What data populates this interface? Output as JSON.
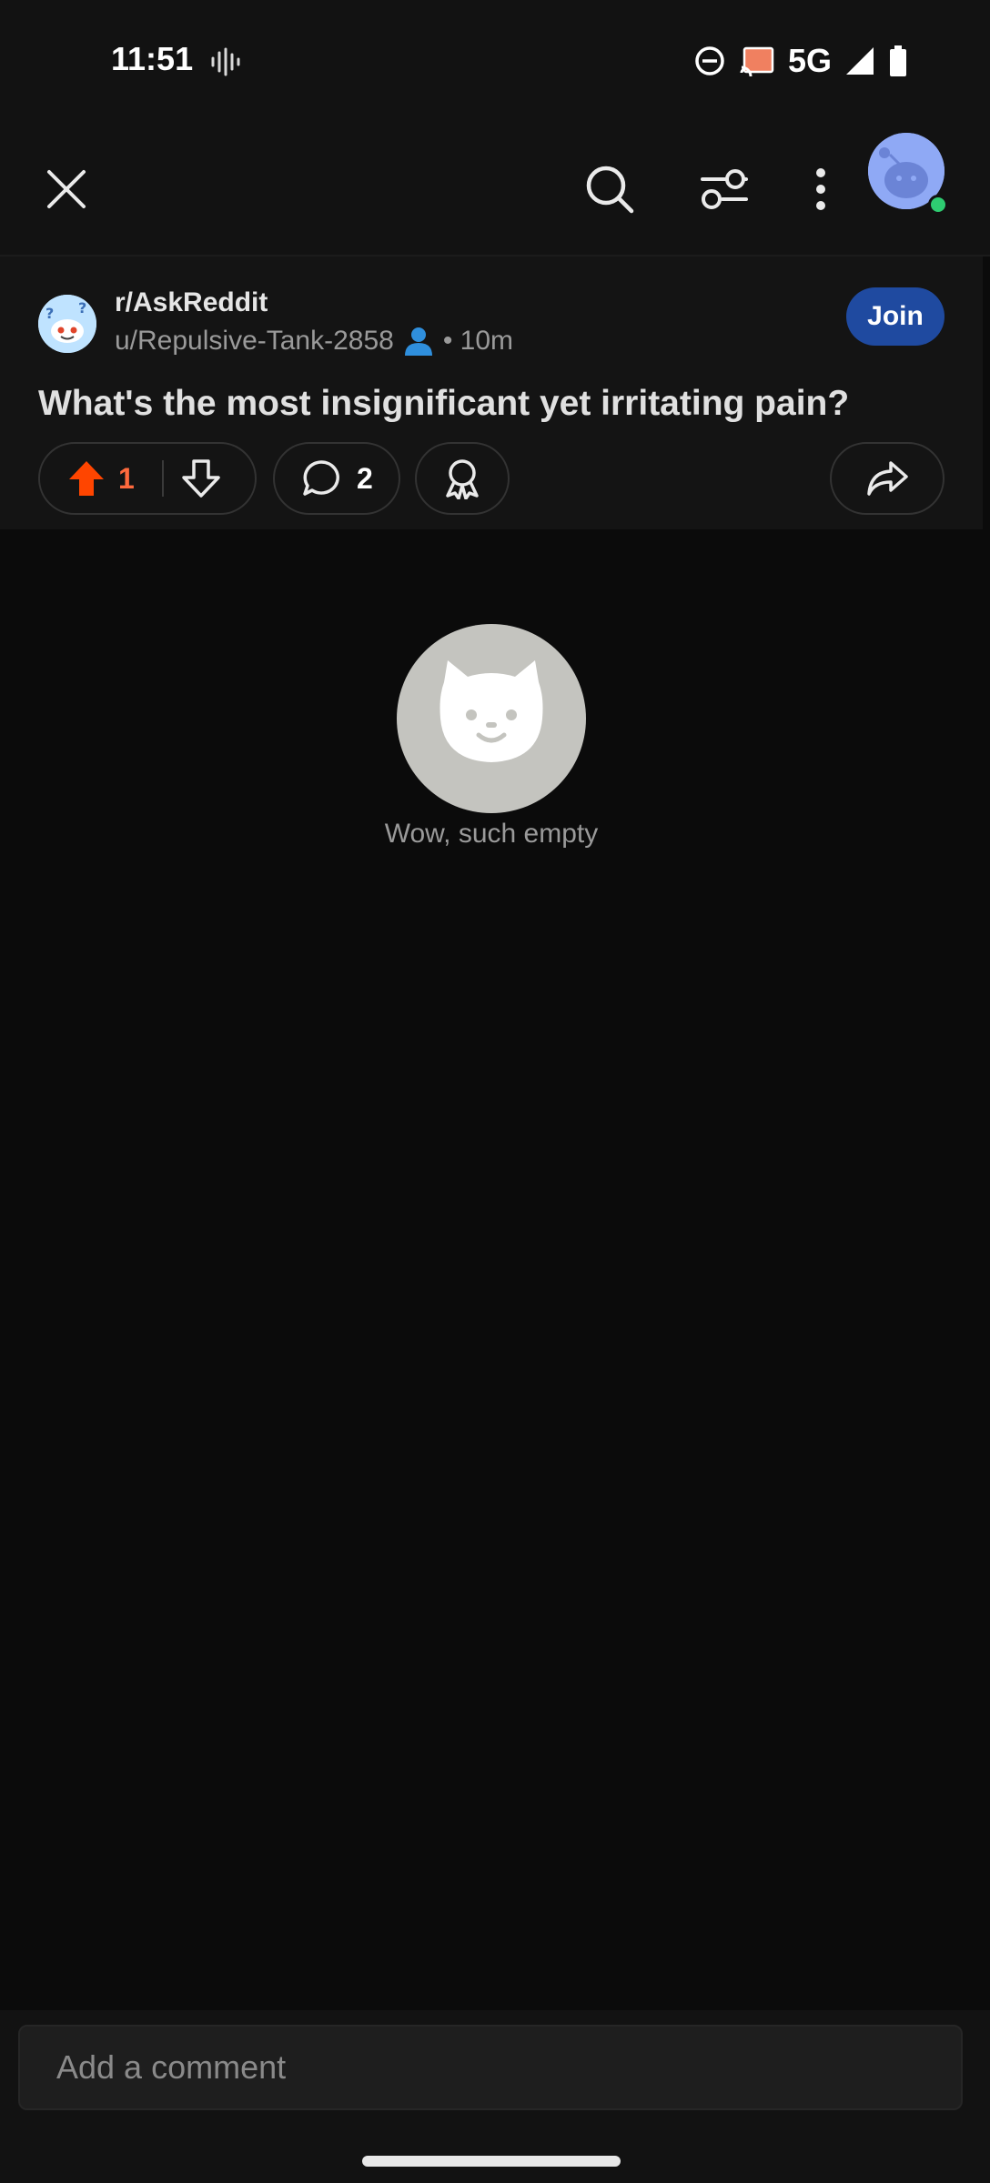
{
  "status_bar": {
    "time": "11:51",
    "network": "5G"
  },
  "header": {
    "close_icon": "close-icon",
    "search_icon": "search-icon",
    "filter_icon": "filter-sliders-icon",
    "more_icon": "more-vertical-icon"
  },
  "post": {
    "subreddit": "r/AskReddit",
    "author": "u/Repulsive-Tank-2858",
    "age": "• 10m",
    "join_label": "Join",
    "title": "What's the most insignificant yet irritating pain?",
    "upvotes": "1",
    "comments": "2"
  },
  "empty_state": {
    "text": "Wow, such empty"
  },
  "comment_bar": {
    "placeholder": "Add a comment"
  },
  "colors": {
    "upvote": "#ff4500",
    "join": "#1f4aa0",
    "online": "#2ecc71"
  }
}
